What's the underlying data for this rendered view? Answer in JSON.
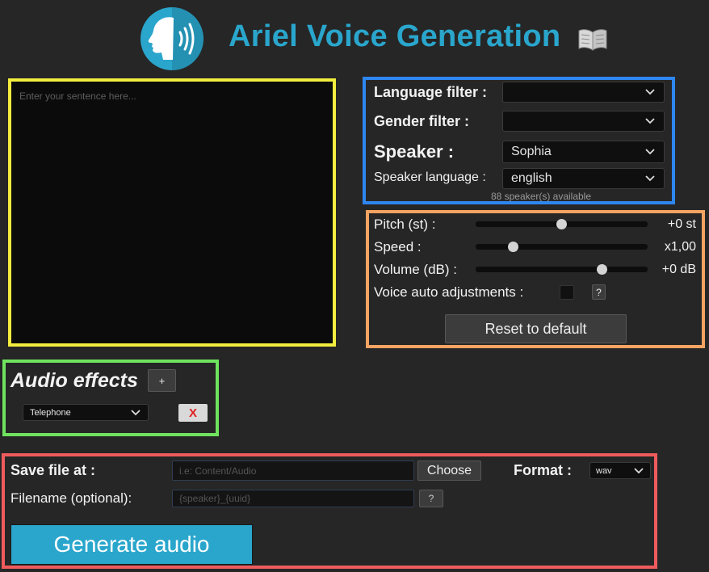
{
  "header": {
    "title": "Ariel Voice Generation",
    "logo_icon": "speaking-head-icon",
    "docs_icon": "open-book-icon"
  },
  "text_input": {
    "placeholder": "Enter your sentence here..."
  },
  "voice": {
    "language_filter_label": "Language filter :",
    "language_filter_value": "",
    "gender_filter_label": "Gender filter :",
    "gender_filter_value": "",
    "speaker_label": "Speaker :",
    "speaker_value": "Sophia",
    "speaker_language_label": "Speaker language :",
    "speaker_language_value": "english",
    "available_text": "88 speaker(s) available"
  },
  "params": {
    "pitch_label": "Pitch (st) :",
    "pitch_value": "+0 st",
    "pitch_level": 0.5,
    "speed_label": "Speed :",
    "speed_value": "x1,00",
    "speed_level": 0.2,
    "volume_label": "Volume (dB) :",
    "volume_value": "+0 dB",
    "volume_level": 0.75,
    "auto_label": "Voice auto adjustments :",
    "auto_checked": false,
    "help_label": "?",
    "reset_label": "Reset to default"
  },
  "effects": {
    "title": "Audio effects",
    "add_label": "+",
    "effect_value": "Telephone",
    "remove_label": "X"
  },
  "save": {
    "save_label": "Save file at :",
    "path_placeholder": "i.e: Content/Audio",
    "choose_label": "Choose",
    "format_label": "Format :",
    "format_value": "wav",
    "filename_label": "Filename (optional):",
    "filename_placeholder": "{speaker}_{uuid}",
    "help_label": "?",
    "generate_label": "Generate audio"
  },
  "colors": {
    "accent": "#2aa6cc",
    "text_frame": "#f2ec3e",
    "voice_frame": "#2e86f0",
    "param_frame": "#f5a362",
    "fx_frame": "#6fe35e",
    "save_frame": "#ef5b5d",
    "remove": "#e02020"
  }
}
